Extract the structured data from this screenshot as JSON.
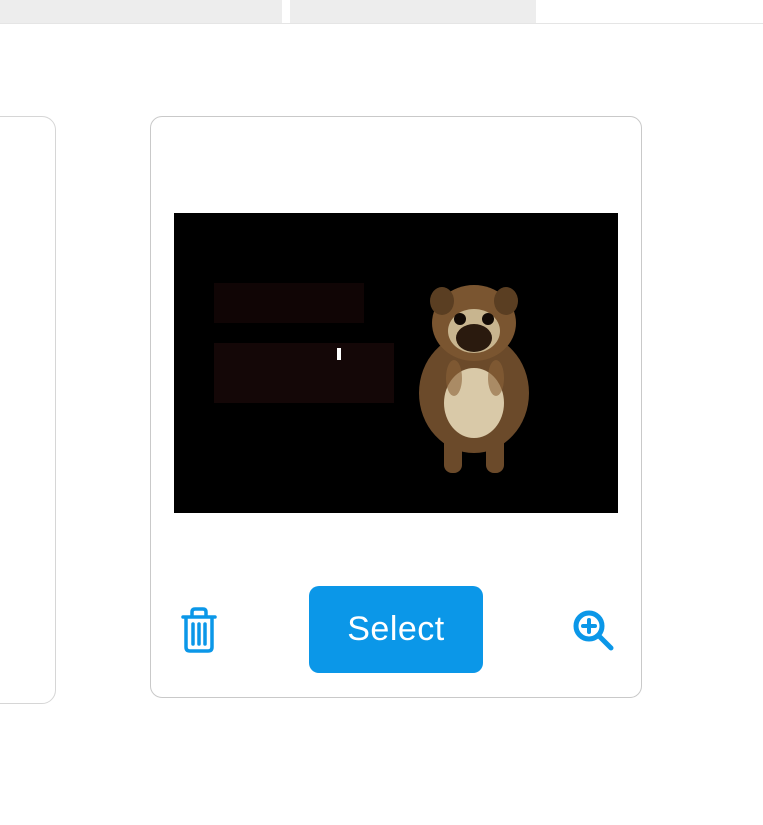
{
  "tabs": [
    {
      "label": ""
    },
    {
      "label": ""
    }
  ],
  "card": {
    "select_label": "Select",
    "thumbnail_alt": "Bulldog on black background"
  },
  "colors": {
    "accent": "#0b97e8"
  }
}
